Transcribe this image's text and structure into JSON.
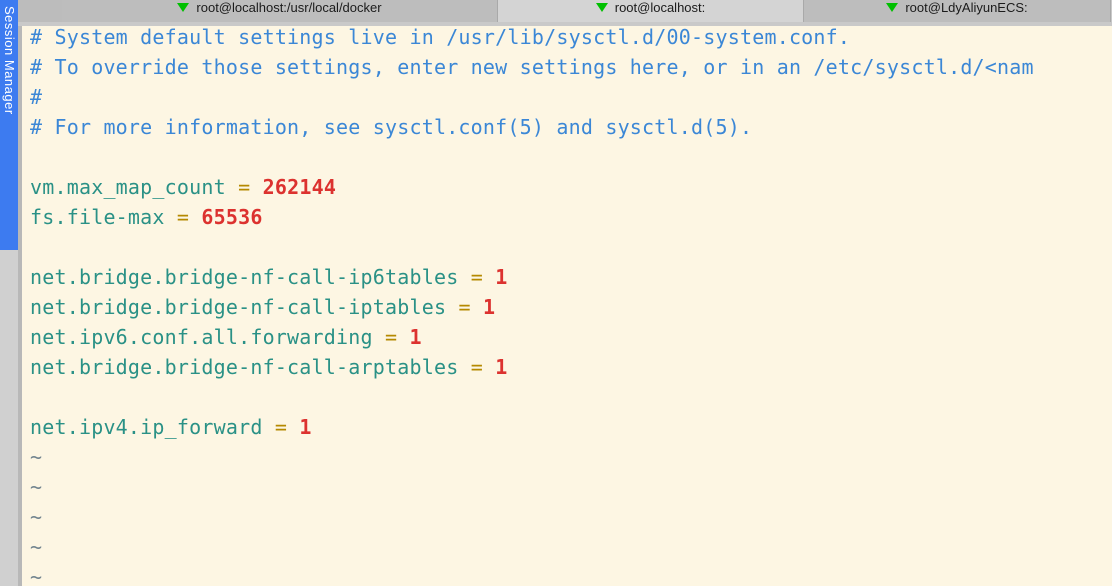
{
  "window": {
    "app_kind": "terminal-emulator",
    "background_color": "#fdf6e3"
  },
  "sidebar": {
    "label": "Session Manager",
    "accent_color": "#3d7bf0",
    "dock_color": "#d0d0d0"
  },
  "tabbar": {
    "bar_color": "#c9c9c9",
    "active_tab_color": "#d4d4d4",
    "inactive_tab_color": "#bdbdbd",
    "icon_name": "green-triangle-icon",
    "icon_color": "#00c000",
    "tabs": [
      {
        "label": "root@localhost:/usr/local/docker",
        "active": false
      },
      {
        "label": "root@localhost:",
        "active": true
      },
      {
        "label": "root@LdyAliyunECS:",
        "active": false
      }
    ]
  },
  "editor": {
    "file_kind": "sysctl.conf",
    "colors": {
      "comment": "#3b87d6",
      "key": "#2a9186",
      "equals": "#b58900",
      "number": "#dc322f",
      "tilde": "#73858f"
    },
    "lines": [
      {
        "type": "comment",
        "text": "# System default settings live in /usr/lib/sysctl.d/00-system.conf."
      },
      {
        "type": "comment",
        "text": "# To override those settings, enter new settings here, or in an /etc/sysctl.d/<nam"
      },
      {
        "type": "comment",
        "text": "#"
      },
      {
        "type": "comment",
        "text": "# For more information, see sysctl.conf(5) and sysctl.d(5)."
      },
      {
        "type": "blank",
        "text": ""
      },
      {
        "type": "setting",
        "key": "vm.max_map_count",
        "eq": "=",
        "value": "262144"
      },
      {
        "type": "setting",
        "key": "fs.file-max",
        "eq": "=",
        "value": "65536"
      },
      {
        "type": "blank",
        "text": ""
      },
      {
        "type": "setting",
        "key": "net.bridge.bridge-nf-call-ip6tables",
        "eq": "=",
        "value": "1"
      },
      {
        "type": "setting",
        "key": "net.bridge.bridge-nf-call-iptables",
        "eq": "=",
        "value": "1"
      },
      {
        "type": "setting",
        "key": "net.ipv6.conf.all.forwarding",
        "eq": "=",
        "value": "1"
      },
      {
        "type": "setting",
        "key": "net.bridge.bridge-nf-call-arptables",
        "eq": "=",
        "value": "1"
      },
      {
        "type": "blank",
        "text": ""
      },
      {
        "type": "setting",
        "key": "net.ipv4.ip_forward",
        "eq": "=",
        "value": "1"
      },
      {
        "type": "tilde",
        "text": "~"
      },
      {
        "type": "tilde",
        "text": "~"
      },
      {
        "type": "tilde",
        "text": "~"
      },
      {
        "type": "tilde",
        "text": "~"
      },
      {
        "type": "tilde",
        "text": "~"
      }
    ]
  }
}
